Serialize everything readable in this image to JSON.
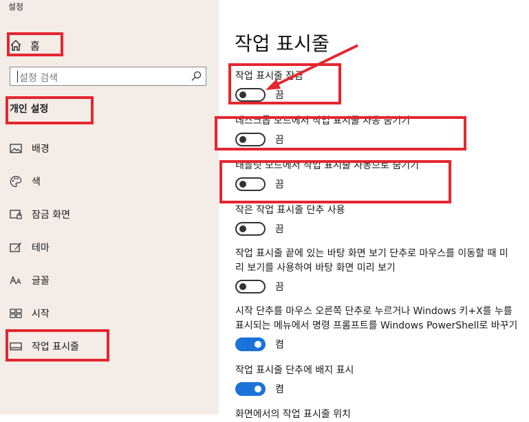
{
  "app_title": "설정",
  "sidebar": {
    "home_label": "홈",
    "search_placeholder": "설정 검색",
    "section_title": "개인 설정",
    "items": [
      {
        "label": "배경",
        "icon": "picture-icon"
      },
      {
        "label": "색",
        "icon": "palette-icon"
      },
      {
        "label": "잠금 화면",
        "icon": "lock-screen-icon"
      },
      {
        "label": "테마",
        "icon": "theme-brush-icon"
      },
      {
        "label": "글꼴",
        "icon": "font-icon"
      },
      {
        "label": "시작",
        "icon": "start-grid-icon"
      },
      {
        "label": "작업 표시줄",
        "icon": "taskbar-icon"
      }
    ]
  },
  "main": {
    "title": "작업 표시줄",
    "settings": [
      {
        "label": "작업 표시줄 잠금",
        "state": "끔"
      },
      {
        "label": "데스크톱 모드에서 작업 표시줄 자동 숨기기",
        "state": "끔"
      },
      {
        "label": "태블릿 모드에서 작업 표시줄 자동으로 숨기기",
        "state": "끔"
      },
      {
        "label": "작은 작업 표시줄 단추 사용",
        "state": "끔"
      },
      {
        "label": "작업 표시줄 끝에 있는 바탕 화면 보기 단추로 마우스를 이동할 때 미",
        "label2": "리 보기를 사용하여 바탕 화면 미리 보기",
        "state": "끔"
      },
      {
        "label": "시작 단추를 마우스 오른쪽 단추로 누르거나 Windows 키+X를 누를",
        "label2": "표시되는 메뉴에서 명령 프롬프트를 Windows PowerShell로 바꾸기",
        "state": "켬"
      },
      {
        "label": "작업 표시줄 단추에 배지 표시",
        "state": "켬"
      },
      {
        "label": "화면에서의 작업 표시줄 위치"
      }
    ]
  },
  "colors": {
    "sidebar_bg": "#f3ece7",
    "accent": "#1a73d9",
    "annotation_red": "#e5262f"
  }
}
